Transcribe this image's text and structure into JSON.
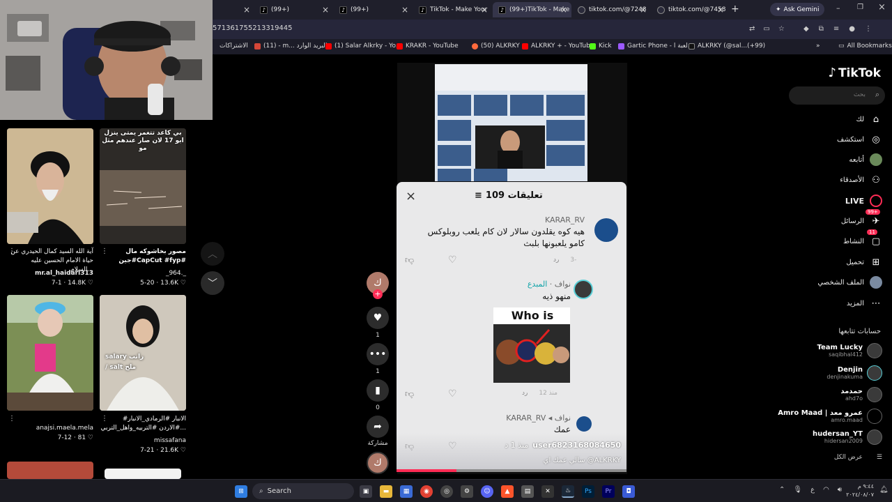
{
  "tabs": [
    {
      "label": ""
    },
    {
      "label": "(99+)"
    },
    {
      "label": "(99+)"
    },
    {
      "label": "TikTok - Make Your"
    },
    {
      "label": "(99+)TikTok - Make"
    },
    {
      "label": "tiktok.com/@7248"
    },
    {
      "label": "tiktok.com/@7458"
    }
  ],
  "browser": {
    "new_tab": "+",
    "ask_gemini": "Ask Gemini",
    "url": "571361755213319445",
    "all_bookmarks": "All Bookmarks"
  },
  "bookmarks": [
    {
      "label": "الاشتراكات",
      "color": "#888888"
    },
    {
      "label": "(11) - m... البريد الوارد",
      "color": "#d44638"
    },
    {
      "label": "(1) Salar Alkrky - Yo...",
      "color": "#ff0000"
    },
    {
      "label": "KRAKR - YouTube",
      "color": "#ff0000"
    },
    {
      "label": "(50) ALKRKY",
      "color": "#ff6a3d"
    },
    {
      "label": "ALKRKY + - YouTube",
      "color": "#ff0000"
    },
    {
      "label": "Kick",
      "color": "#53fc18"
    },
    {
      "label": "Gartic Phone - لعبة ا...",
      "color": "#9b59ff"
    },
    {
      "label": "ALKRKY (@sal...(+99)",
      "color": "#111111"
    }
  ],
  "left_feed": [
    {
      "caption": "آية الله السيد كمال الحيدري عن حياة الامام الحسين عليه السلام...",
      "user": "mr.al_haidari313",
      "stats": "7-1 · 14.8K ♡",
      "overlay": ""
    },
    {
      "caption": "مصور بخاشوكه مال جين#CapCut #fyp#",
      "user": "_964._",
      "stats": "5-20 · 13.6K ♡",
      "overlay": "بي كاعد تتغمر يمتى ينزل ابو 17 لان صار عندهم مثل مو"
    },
    {
      "caption": "",
      "user": "anajsi.maela.mela",
      "stats": "7-12 · 81 ♡",
      "overlay": ""
    },
    {
      "caption": "#الانبار #الرمادي_الانبار #الاردن #التربيه_واهل_التربي...",
      "user": "missafana",
      "stats": "7-21 · 21.6K ♡",
      "overlay": "salary راتب / salt ملح"
    }
  ],
  "left_feed_more": "...",
  "comments": {
    "title": "109 تعليقات",
    "close": "×",
    "items": [
      {
        "user": "KARAR_RV",
        "text": "هيه كوه يقلدون سالار لان كام يلعب روبلوكس كامو يلعبونها بلبث",
        "date": "3-",
        "reply": "رد",
        "badge": ""
      },
      {
        "user": "نواف",
        "badge": "المبدع",
        "text": "منهو ذيه",
        "date": "منذ 12",
        "reply": "رد",
        "image_text": "Who is this?"
      },
      {
        "user": "KARAR_RV ◂ نواف",
        "text": "عمك",
        "date": "",
        "reply": "",
        "badge": ""
      }
    ],
    "overlay_user": "user6823168084650",
    "overlay_time": "منذ 1 د",
    "overlay_caption": "سالي عمك اي @ALKRKY"
  },
  "rail": {
    "avatar_letter": "ك",
    "likes": "1",
    "comments": "1",
    "saves": "0",
    "share": "مشاركة"
  },
  "sidebar": {
    "logo": "TikTok",
    "search_placeholder": "بحث",
    "nav": [
      {
        "label": "لك",
        "icon": "home-icon"
      },
      {
        "label": "استكشف",
        "icon": "compass-icon"
      },
      {
        "label": "أتابعه",
        "icon": "following-icon"
      },
      {
        "label": "الأصدقاء",
        "icon": "friends-icon"
      },
      {
        "label": "LIVE",
        "icon": "live-icon"
      },
      {
        "label": "الرسائل",
        "icon": "messages-icon",
        "badge": "99+"
      },
      {
        "label": "النشاط",
        "icon": "activity-icon",
        "badge": "11"
      },
      {
        "label": "تحميل",
        "icon": "upload-icon"
      },
      {
        "label": "الملف الشخصي",
        "icon": "profile-icon"
      },
      {
        "label": "المزيد",
        "icon": "more-icon"
      }
    ],
    "following_title": "حسابات تتابعها",
    "following": [
      {
        "name": "Team Lucky",
        "handle": "saqibhal412"
      },
      {
        "name": "Denjin",
        "handle": "denjinakuma"
      },
      {
        "name": "حمدمد",
        "handle": "ahd7o"
      },
      {
        "name": "Amro Maad | عمرو معد",
        "handle": "amro.maad"
      },
      {
        "name": "hudersan_YT",
        "handle": "hidersan2009"
      }
    ],
    "see_all": "عرض الكل"
  },
  "taskbar": {
    "search": "Search",
    "time": "٩:٤٤ م",
    "date": "٢٠٢٤/٠٨/٠٧",
    "lang": "ع"
  }
}
